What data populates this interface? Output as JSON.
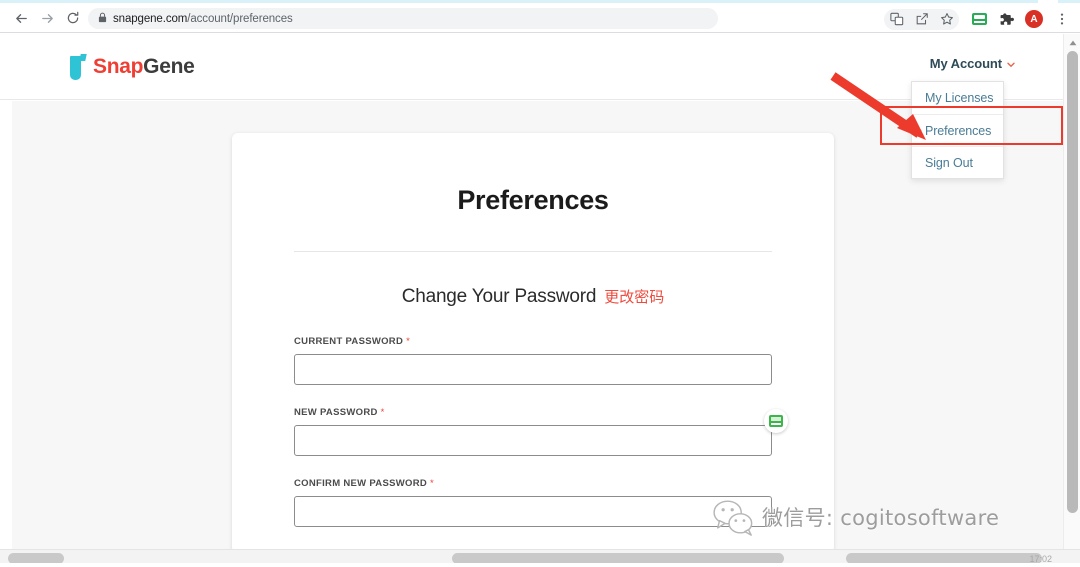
{
  "browser": {
    "back_icon": "back-arrow",
    "forward_icon": "forward-arrow",
    "reload_icon": "reload",
    "lock_icon": "lock",
    "url_domain": "snapgene.com",
    "url_path": "/account/preferences",
    "toolbar_icons": {
      "translate": "translate-icon",
      "share": "share-icon",
      "bookmark": "star-icon",
      "password_manager": "password-manager-extension-icon",
      "extensions": "puzzle-piece-icon",
      "profile_initial": "A",
      "menu": "three-dot-menu-icon"
    }
  },
  "site_header": {
    "logo_snap": "Snap",
    "logo_gene": "Gene",
    "account_label": "My Account",
    "account_chevron": "˅"
  },
  "account_dropdown": {
    "items": [
      {
        "label": "My Licenses"
      },
      {
        "label": "Preferences"
      },
      {
        "label": "Sign Out"
      }
    ]
  },
  "card": {
    "title": "Preferences",
    "section_heading": "Change Your Password",
    "section_heading_cn": "更改密码",
    "fields": [
      {
        "label": "CURRENT PASSWORD",
        "required": "*",
        "value": "",
        "placeholder": ""
      },
      {
        "label": "NEW PASSWORD",
        "required": "*",
        "value": "",
        "placeholder": ""
      },
      {
        "label": "CONFIRM NEW PASSWORD",
        "required": "*",
        "value": "",
        "placeholder": ""
      }
    ]
  },
  "annotations": {
    "arrow_color": "#ec3a2d",
    "box_color": "#ec3a2d",
    "highlighted_item": "Preferences"
  },
  "watermark": {
    "text": "微信号: cogitosoftware",
    "icon": "wechat-icon"
  },
  "scrollbars": {
    "vertical_up_arrow": "▲",
    "bottom_time": "17:02"
  },
  "colors": {
    "brand_red": "#ef3e33",
    "brand_teal": "#2fc3d6",
    "link_blue": "#4a7c96",
    "annotation_red": "#ec3a2d",
    "required_red": "#ef4136",
    "page_bg": "#f7f7f7"
  }
}
